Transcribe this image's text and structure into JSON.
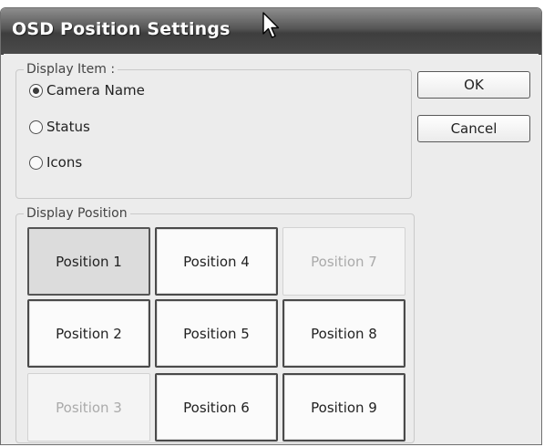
{
  "window": {
    "title": "OSD Position Settings"
  },
  "display_item": {
    "label": "Display Item :",
    "options": [
      {
        "label": "Camera Name",
        "selected": true
      },
      {
        "label": "Status",
        "selected": false
      },
      {
        "label": "Icons",
        "selected": false
      }
    ]
  },
  "buttons": {
    "ok": "OK",
    "cancel": "Cancel"
  },
  "display_position": {
    "label": "Display Position",
    "positions": [
      {
        "label": "Position 1",
        "state": "selected"
      },
      {
        "label": "Position 2",
        "state": "normal"
      },
      {
        "label": "Position 3",
        "state": "disabled"
      },
      {
        "label": "Position 4",
        "state": "normal"
      },
      {
        "label": "Position 5",
        "state": "normal"
      },
      {
        "label": "Position 6",
        "state": "normal"
      },
      {
        "label": "Position 7",
        "state": "disabled"
      },
      {
        "label": "Position 8",
        "state": "normal"
      },
      {
        "label": "Position 9",
        "state": "normal"
      }
    ]
  },
  "icons": {
    "cursor": "mouse-pointer-icon"
  },
  "colors": {
    "titlebar": "#4a4a4a",
    "dialog_bg": "#ececec",
    "disabled_text": "#aaaaaa"
  }
}
